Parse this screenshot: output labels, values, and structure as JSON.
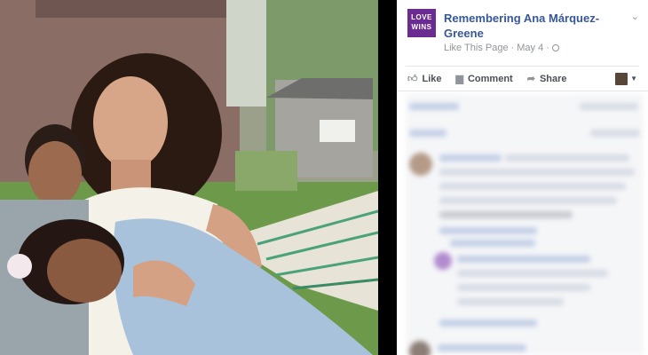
{
  "post": {
    "page_name": "Remembering Ana Márquez-Greene",
    "meta_like": "Like This Page",
    "meta_sep": "·",
    "meta_date": "May 4",
    "meta_sep2": "·",
    "avatar_text": "LOVE WINS"
  },
  "actions": {
    "like": "Like",
    "comment": "Comment",
    "share": "Share"
  },
  "icons": {
    "like": "thumbs-up-icon",
    "comment": "comment-icon",
    "share": "share-arrow-icon",
    "globe": "globe-icon",
    "options": "chevron-down-icon"
  },
  "colors": {
    "page_link": "#365899",
    "avatar_bg": "#6a2c91",
    "muted": "#90949c"
  }
}
